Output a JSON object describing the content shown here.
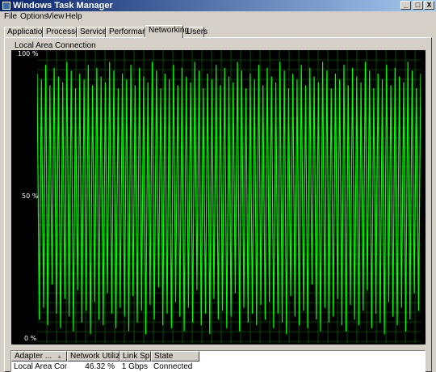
{
  "window": {
    "title": "Windows Task Manager",
    "buttons": {
      "minimize": "_",
      "maximize": "□",
      "close": "X"
    }
  },
  "menu": {
    "items": [
      "File",
      "Options",
      "View",
      "Help"
    ]
  },
  "tabs": [
    {
      "label": "Applications",
      "active": false
    },
    {
      "label": "Processes",
      "active": false
    },
    {
      "label": "Services",
      "active": false
    },
    {
      "label": "Performance",
      "active": false
    },
    {
      "label": "Networking",
      "active": true
    },
    {
      "label": "Users",
      "active": false
    }
  ],
  "graph": {
    "title": "Local Area Connection",
    "y_labels": {
      "top": "100 %",
      "mid": "50 %",
      "bottom": "0 %"
    },
    "colors": {
      "background": "#000000",
      "grid": "#008000",
      "line": "#00ff00"
    }
  },
  "chart_data": {
    "type": "line",
    "title": "Local Area Connection",
    "ylim": [
      0,
      100
    ],
    "grid": true,
    "series": [
      {
        "values": [
          92,
          8,
          90,
          12,
          95,
          6,
          88,
          20,
          94,
          10,
          91,
          5,
          89,
          15,
          96,
          9,
          93,
          4,
          87,
          18,
          92,
          7,
          90,
          11,
          95,
          3,
          88,
          14,
          94,
          8,
          91,
          6,
          89,
          17,
          96,
          10,
          93,
          5,
          87,
          12,
          92,
          9,
          90,
          4,
          95,
          16,
          88,
          7,
          94,
          11,
          91,
          3,
          89,
          13,
          96,
          8,
          93,
          19,
          87,
          6,
          92,
          10,
          90,
          5,
          95,
          14,
          88,
          9,
          94,
          4,
          91,
          12,
          89,
          7,
          96,
          18,
          93,
          6,
          87,
          10,
          92,
          3,
          90,
          15,
          95,
          8,
          88,
          11,
          94,
          5,
          91,
          9,
          89,
          17,
          96,
          4,
          93,
          12,
          87,
          7,
          92,
          10,
          90,
          6,
          95,
          13,
          88,
          8,
          94,
          14,
          91,
          5,
          89,
          10,
          96,
          7,
          93,
          3,
          87,
          16,
          92,
          9,
          90,
          6,
          95,
          11,
          88,
          5,
          94,
          20,
          91,
          8,
          89,
          4,
          96,
          12,
          93,
          7,
          87,
          9,
          92,
          15,
          90,
          6,
          95,
          4,
          88,
          13,
          94,
          8,
          91,
          6,
          89,
          11,
          96,
          18,
          93,
          5,
          87,
          10,
          92,
          7,
          90,
          3,
          95,
          14,
          88,
          9,
          94,
          6,
          91,
          12,
          89,
          4,
          96,
          8,
          93,
          17,
          87,
          11,
          92
        ]
      }
    ]
  },
  "adapter_table": {
    "columns": [
      "Adapter ...",
      "Network Utiliza...",
      "Link Sp...",
      "State"
    ],
    "rows": [
      [
        "Local Area Conn...",
        "46.32 %",
        "1 Gbps",
        "Connected"
      ]
    ]
  }
}
